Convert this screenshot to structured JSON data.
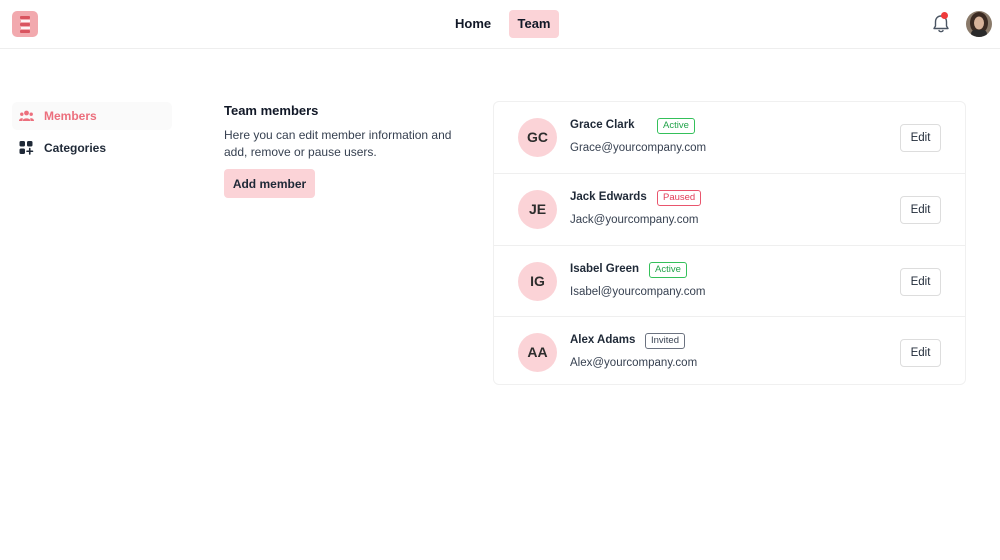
{
  "nav": {
    "links": [
      {
        "label": "Home",
        "active": false
      },
      {
        "label": "Team",
        "active": true
      }
    ]
  },
  "sidebar": {
    "items": [
      {
        "label": "Members",
        "icon": "users-icon",
        "active": true
      },
      {
        "label": "Categories",
        "icon": "grid-plus-icon",
        "active": false
      }
    ]
  },
  "intro": {
    "title": "Team members",
    "description": "Here you can edit member information and add, remove or pause users.",
    "add_button": "Add member"
  },
  "members": [
    {
      "initials": "GC",
      "name": "Grace Clark",
      "status": "Active",
      "email": "Grace@yourcompany.com",
      "edit_label": "Edit"
    },
    {
      "initials": "JE",
      "name": "Jack Edwards",
      "status": "Paused",
      "email": "Jack@yourcompany.com",
      "edit_label": "Edit"
    },
    {
      "initials": "IG",
      "name": "Isabel Green",
      "status": "Active",
      "email": "Isabel@yourcompany.com",
      "edit_label": "Edit"
    },
    {
      "initials": "AA",
      "name": "Alex Adams",
      "status": "Invited",
      "email": "Alex@yourcompany.com",
      "edit_label": "Edit"
    }
  ],
  "colors": {
    "accent": "#fbd3d7",
    "accent_text": "#ec6f7d",
    "status_active": "#22a34a",
    "status_paused": "#e23c57",
    "status_invited": "#374151",
    "notification_dot": "#ef3b3b"
  }
}
